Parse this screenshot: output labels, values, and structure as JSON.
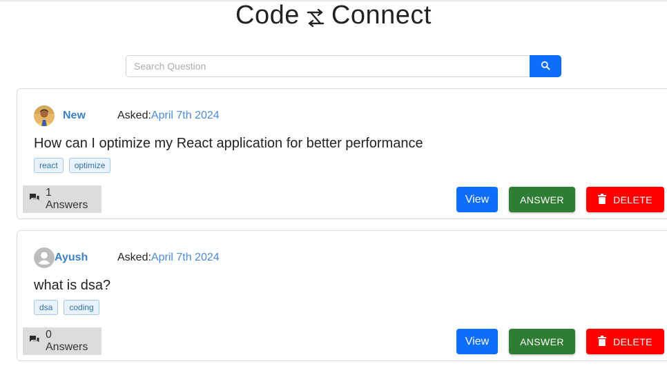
{
  "brand": {
    "left": "Code",
    "right": "Connect",
    "icon": "shuffle-arrows-icon"
  },
  "search": {
    "placeholder": "Search Question",
    "value": "",
    "button_icon": "search-icon"
  },
  "questions": [
    {
      "author": "New",
      "avatar": "photo-avatar",
      "asked_label": "Asked:",
      "asked_date": "April 7th 2024",
      "title": "How can I optimize my React application for better performance",
      "tags": [
        "react",
        "optimize"
      ],
      "answers_text": "1 Answers"
    },
    {
      "author": "Ayush",
      "avatar": "default-user-avatar",
      "asked_label": "Asked:",
      "asked_date": "April 7th 2024",
      "title": "what is dsa?",
      "tags": [
        "dsa",
        "coding"
      ],
      "answers_text": "0 Answers"
    }
  ],
  "actions": {
    "view_label": "View",
    "answer_label": "ANSWER",
    "delete_label": "DELETE"
  },
  "colors": {
    "primary": "#0d6efd",
    "answer": "#2e7d32",
    "delete": "#ff0000",
    "author": "#3b82c4",
    "date": "#4a8ad6"
  }
}
